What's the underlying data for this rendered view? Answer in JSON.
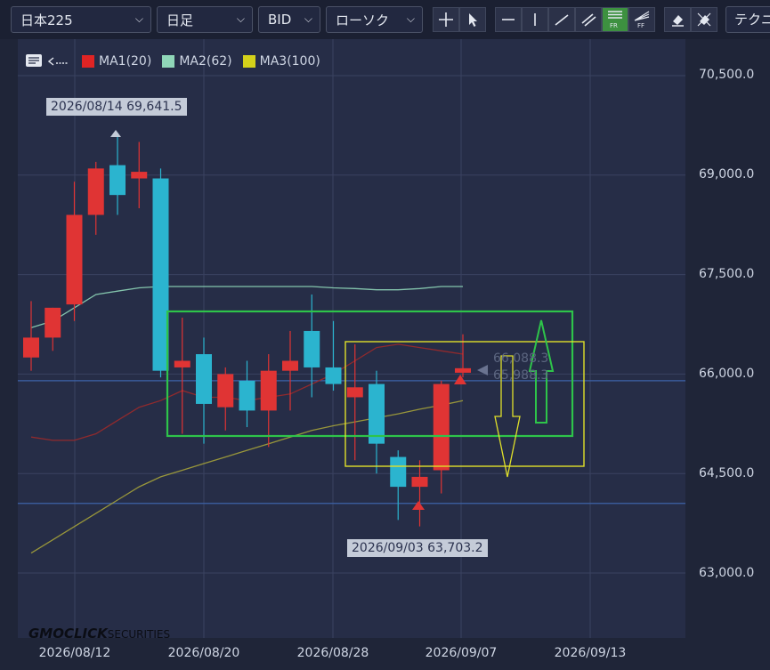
{
  "toolbar": {
    "symbol": "日本225",
    "timeframe": "日足",
    "price_type": "BID",
    "chart_type": "ローソク",
    "tech_label": "テクニ",
    "tool_icons": [
      "crosshair-icon",
      "pointer-icon",
      "horizontal-line-icon",
      "vertical-line-icon",
      "trend-line-icon",
      "channel-icon",
      "fibonacci-retracement-icon",
      "fibonacci-fan-icon",
      "eraser-icon",
      "eraser-all-icon"
    ],
    "fr_label": "FR",
    "ff_label": "FF",
    "active_tool": "fibonacci-retracement-icon"
  },
  "legend": {
    "ma1": "MA1(20)",
    "ma2": "MA2(62)",
    "ma3": "MA3(100)",
    "ma1_color": "#e02424",
    "ma2_color": "#8fd6b8",
    "ma3_color": "#d4d11a"
  },
  "annotations": {
    "high_label": "2026/08/14 69,641.5",
    "low_label": "2026/09/03 63,703.2",
    "current_price": "66,088.3",
    "current_price_2": "65,988.3"
  },
  "branding": {
    "logo": "GMOCLICK",
    "logo_sub": "SECURITIES"
  },
  "chart_data": {
    "type": "candlestick",
    "ylim": [
      62000,
      71000
    ],
    "y_ticks": [
      "70,500.0",
      "69,000.0",
      "67,500.0",
      "66,000.0",
      "64,500.0",
      "63,000.0"
    ],
    "x_ticks": [
      "2026/08/12",
      "2026/08/20",
      "2026/08/28",
      "2026/09/07",
      "2026/09/13"
    ],
    "colors": {
      "up": "#e03434",
      "down": "#2bb4cf"
    },
    "candles": [
      {
        "o": 66250,
        "h": 67100,
        "l": 66050,
        "c": 66550
      },
      {
        "o": 66550,
        "h": 67000,
        "l": 66350,
        "c": 67000
      },
      {
        "o": 67050,
        "h": 68900,
        "l": 66800,
        "c": 68400
      },
      {
        "o": 68400,
        "h": 69200,
        "l": 68100,
        "c": 69100
      },
      {
        "o": 69150,
        "h": 69640,
        "l": 68400,
        "c": 68700
      },
      {
        "o": 68950,
        "h": 69500,
        "l": 68500,
        "c": 69050
      },
      {
        "o": 68950,
        "h": 69100,
        "l": 65950,
        "c": 66050
      },
      {
        "o": 66100,
        "h": 66850,
        "l": 65100,
        "c": 66200
      },
      {
        "o": 66300,
        "h": 66550,
        "l": 64950,
        "c": 65550
      },
      {
        "o": 65500,
        "h": 66100,
        "l": 65150,
        "c": 66000
      },
      {
        "o": 65900,
        "h": 66200,
        "l": 65200,
        "c": 65450
      },
      {
        "o": 65450,
        "h": 66300,
        "l": 64900,
        "c": 66050
      },
      {
        "o": 66050,
        "h": 66650,
        "l": 65450,
        "c": 66200
      },
      {
        "o": 66650,
        "h": 67200,
        "l": 65650,
        "c": 66100
      },
      {
        "o": 66100,
        "h": 66800,
        "l": 65750,
        "c": 65850
      },
      {
        "o": 65650,
        "h": 66450,
        "l": 64700,
        "c": 65800
      },
      {
        "o": 65850,
        "h": 66050,
        "l": 64500,
        "c": 64950
      },
      {
        "o": 64750,
        "h": 64850,
        "l": 63800,
        "c": 64300
      },
      {
        "o": 64300,
        "h": 64700,
        "l": 63703,
        "c": 64450
      },
      {
        "o": 64550,
        "h": 65900,
        "l": 64200,
        "c": 65850
      },
      {
        "o": 66020,
        "h": 66600,
        "l": 65950,
        "c": 66088
      }
    ],
    "ma1": [
      65050,
      65000,
      65000,
      65100,
      65300,
      65500,
      65600,
      65750,
      65650,
      65650,
      65600,
      65650,
      65700,
      65850,
      66000,
      66200,
      66400,
      66450,
      66400,
      66350,
      66300
    ],
    "ma2": [
      66700,
      66800,
      67000,
      67200,
      67250,
      67300,
      67320,
      67320,
      67320,
      67320,
      67320,
      67320,
      67320,
      67320,
      67300,
      67290,
      67270,
      67270,
      67290,
      67320,
      67320
    ],
    "ma3": [
      63300,
      63500,
      63700,
      63900,
      64100,
      64300,
      64450,
      64550,
      64650,
      64750,
      64850,
      64950,
      65050,
      65150,
      65220,
      65280,
      65340,
      65400,
      65470,
      65530,
      65600
    ],
    "horizontal_lines": [
      65900,
      64050
    ]
  }
}
